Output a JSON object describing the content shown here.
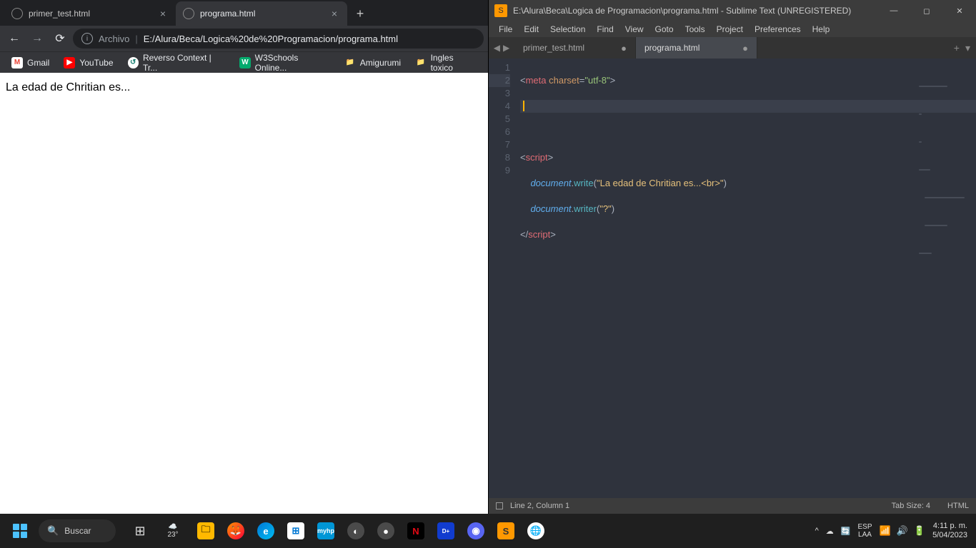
{
  "chrome": {
    "tabs": [
      {
        "title": "primer_test.html",
        "active": false
      },
      {
        "title": "programa.html",
        "active": true
      }
    ],
    "url_prefix": "Archivo",
    "url_path": "E:/Alura/Beca/Logica%20de%20Programacion/programa.html",
    "bookmarks": [
      {
        "label": "Gmail",
        "iconClass": "bm-gmail",
        "iconText": "M"
      },
      {
        "label": "YouTube",
        "iconClass": "bm-yt",
        "iconText": "▶"
      },
      {
        "label": "Reverso Context | Tr...",
        "iconClass": "bm-rev",
        "iconText": "↺"
      },
      {
        "label": "W3Schools Online...",
        "iconClass": "bm-w3",
        "iconText": "W"
      },
      {
        "label": "Amigurumi",
        "iconClass": "bm-folder",
        "iconText": "📁"
      },
      {
        "label": "Ingles toxico",
        "iconClass": "bm-folder",
        "iconText": "📁"
      }
    ],
    "page_text": "La edad de Chritian es..."
  },
  "sublime": {
    "title": "E:\\Alura\\Beca\\Logica de Programacion\\programa.html - Sublime Text (UNREGISTERED)",
    "menus": [
      "File",
      "Edit",
      "Selection",
      "Find",
      "View",
      "Goto",
      "Tools",
      "Project",
      "Preferences",
      "Help"
    ],
    "tabs": [
      {
        "name": "primer_test.html",
        "active": false,
        "dirty": true
      },
      {
        "name": "programa.html",
        "active": true,
        "dirty": true
      }
    ],
    "line_numbers": [
      "1",
      "2",
      "3",
      "4",
      "5",
      "6",
      "7",
      "8",
      "9"
    ],
    "active_line_index": 1,
    "status_text": "Line 2, Column 1",
    "tab_size": "Tab Size: 4",
    "syntax": "HTML",
    "code_tokens": {
      "l1": {
        "tag": "meta",
        "attr": "charset",
        "val": "\"utf-8\""
      },
      "l4": {
        "tag": "script"
      },
      "l5": {
        "obj": "document",
        "method": "write",
        "str": "\"La edad de Chritian es...<br>\""
      },
      "l6": {
        "obj": "document",
        "method": "writer",
        "str": "\"?\""
      },
      "l7": {
        "tag": "script"
      }
    }
  },
  "taskbar": {
    "search_placeholder": "Buscar",
    "weather_temp": "23°",
    "lang_top": "ESP",
    "lang_bottom": "LAA",
    "time": "4:11 p. m.",
    "date": "5/04/2023"
  }
}
